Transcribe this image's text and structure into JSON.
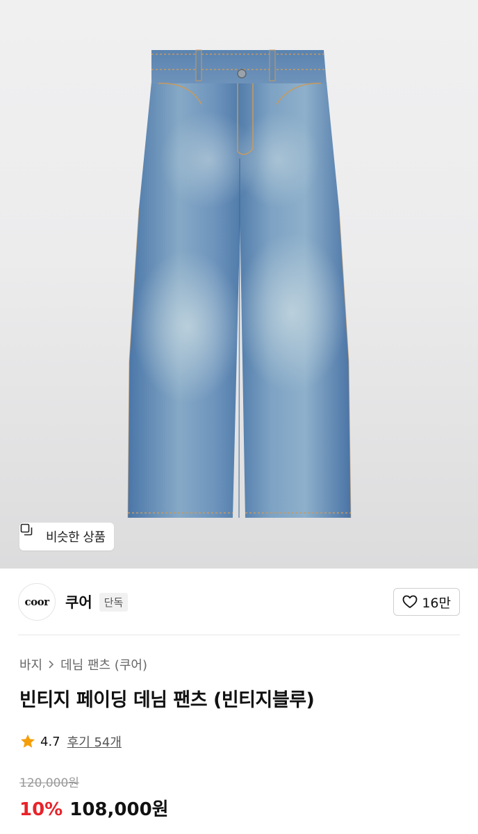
{
  "product_image": {
    "similar_button_label": "비슷한 상품"
  },
  "brand": {
    "logo_text": "coor",
    "name": "쿠어",
    "badge": "단독",
    "like_count": "16만"
  },
  "breadcrumb": [
    "바지",
    "데님 팬츠 (쿠어)"
  ],
  "product": {
    "title": "빈티지 페이딩 데님 팬츠 (빈티지블루)",
    "rating": "4.7",
    "reviews_label": "후기 54개",
    "original_price": "120,000원",
    "discount": "10%",
    "sale_price": "108,000원"
  },
  "colors": {
    "accent_red": "#e8232a",
    "star_orange": "#f59e0b",
    "denim_base": "#5d86b4"
  },
  "icons": {
    "similar": "copy-squares-icon",
    "like": "heart-outline-icon",
    "breadcrumb_separator": "chevron-right-icon",
    "rating": "star-filled-icon"
  }
}
